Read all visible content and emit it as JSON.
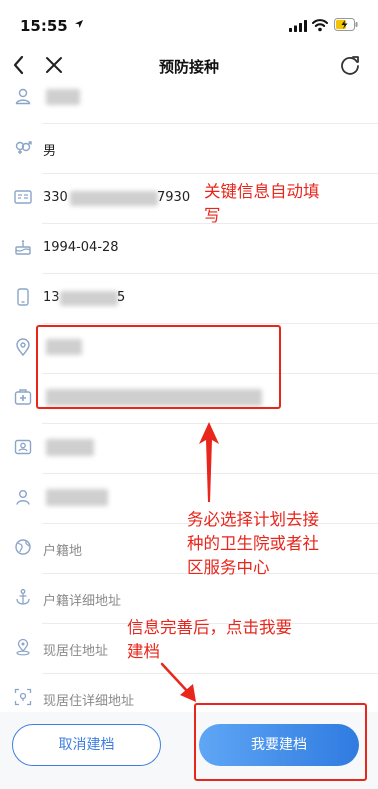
{
  "status_bar": {
    "time": "15:55",
    "icons": [
      "location-arrow-icon",
      "signal-icon",
      "wifi-icon",
      "battery-charging-icon"
    ]
  },
  "nav": {
    "title": "预防接种",
    "back_icon": "chevron-left-icon",
    "close_icon": "close-icon",
    "refresh_icon": "refresh-icon"
  },
  "form": {
    "rows": [
      {
        "icon": "person-icon",
        "value": ""
      },
      {
        "icon": "gender-icon",
        "value": "男"
      },
      {
        "icon": "id-card-icon",
        "value_prefix": "330",
        "value_suffix": "7930"
      },
      {
        "icon": "birthday-cake-icon",
        "value": "1994-04-28"
      },
      {
        "icon": "phone-icon",
        "value_prefix": "13",
        "value_suffix": "5"
      },
      {
        "icon": "location-pin-icon",
        "value": ""
      },
      {
        "icon": "hospital-icon",
        "value": ""
      },
      {
        "icon": "badge-icon",
        "value": ""
      },
      {
        "icon": "person-outline-icon",
        "value": ""
      },
      {
        "icon": "globe-icon",
        "placeholder": "户籍地"
      },
      {
        "icon": "anchor-icon",
        "placeholder": "户籍详细地址"
      },
      {
        "icon": "map-pin-icon",
        "placeholder": "现居住地址"
      },
      {
        "icon": "focus-icon",
        "placeholder": "现居住详细地址"
      }
    ]
  },
  "annotations": {
    "key_info_line1": "关键信息自动填",
    "key_info_line2": "写",
    "select_line1": "务必选择计划去接",
    "select_line2": "种的卫生院或者社",
    "select_line3": "区服务中心",
    "complete_line1": "信息完善后，点击我要",
    "complete_line2": "建档",
    "color": "#e8261c"
  },
  "buttons": {
    "cancel": "取消建档",
    "submit": "我要建档",
    "accent": "#3f7fe0"
  }
}
